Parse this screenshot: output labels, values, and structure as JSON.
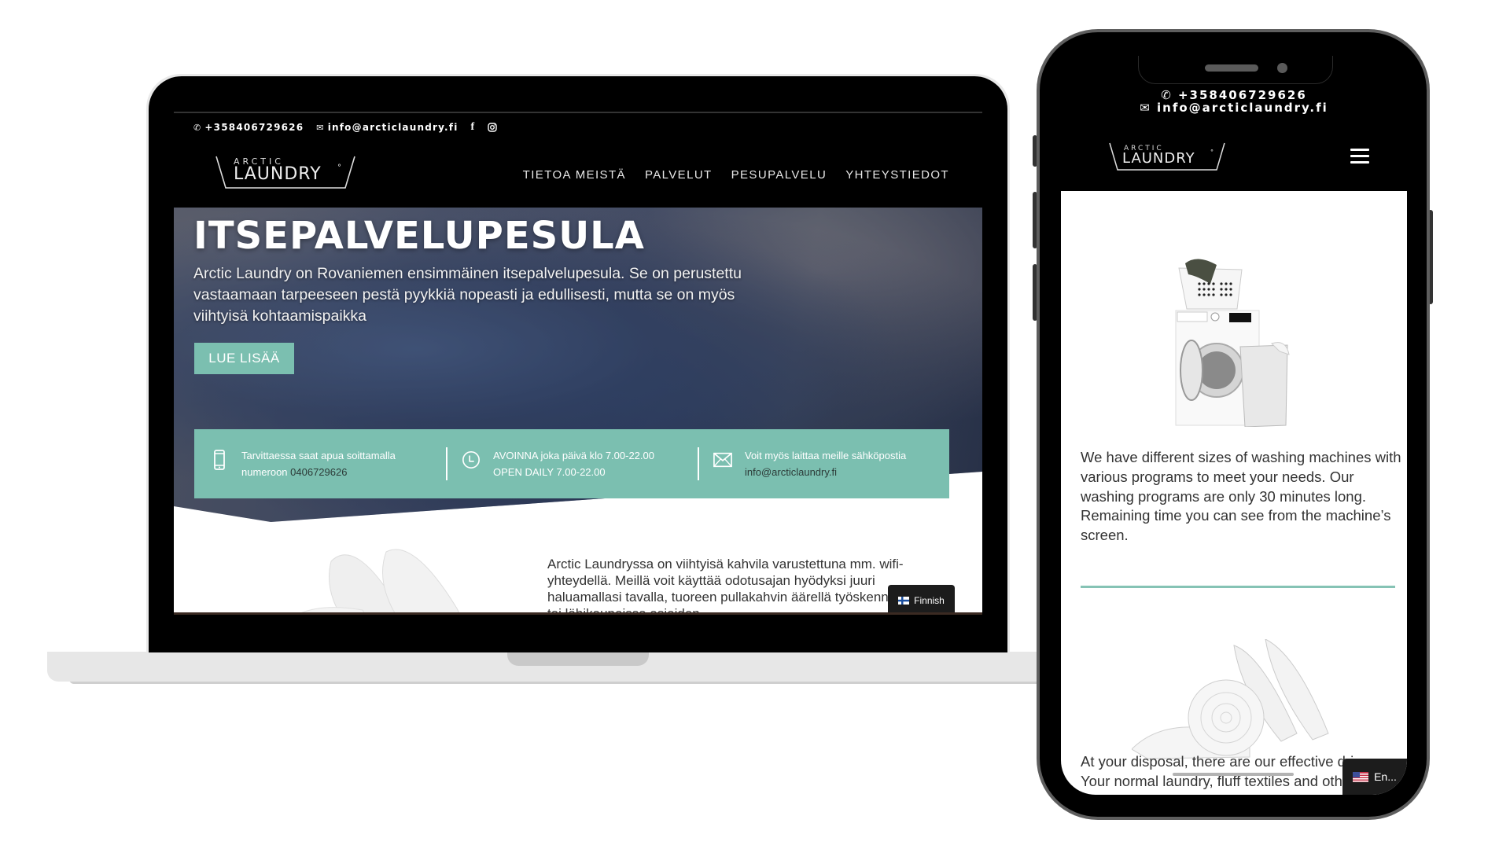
{
  "laptop": {
    "topbar": {
      "phone": "+358406729626",
      "email": "info@arcticlaundry.fi",
      "social": [
        "facebook",
        "instagram"
      ]
    },
    "logo": {
      "line1": "ARCTIC",
      "line2": "LAUNDRY",
      "mark": "°"
    },
    "nav": [
      {
        "label": "TIETOA MEISTÄ"
      },
      {
        "label": "PALVELUT"
      },
      {
        "label": "PESUPALVELU"
      },
      {
        "label": "YHTEYSTIEDOT"
      }
    ],
    "hero": {
      "title": "ITSEPALVELUPESULA",
      "text": "Arctic Laundry on Rovaniemen ensimmäinen itsepalvelupesula. Se on perustettu vastaamaan tarpeeseen pestä pyykkiä nopeasti ja edullisesti, mutta se on myös viihtyisä kohtaamispaikka",
      "button": "LUE LISÄÄ"
    },
    "info": [
      {
        "icon": "mobile-phone-icon",
        "line1": "Tarvittaessa saat apua soittamalla",
        "line2_prefix": "numeroon ",
        "line2_value": "0406729626"
      },
      {
        "icon": "clock-icon",
        "line1": "AVOINNA joka päivä klo 7.00-22.00",
        "line2_prefix": "OPEN DAILY 7.00-22.00",
        "line2_value": ""
      },
      {
        "icon": "envelope-icon",
        "line1": "Voit myös laittaa meille sähköpostia",
        "line2_prefix": "",
        "line2_value": "info@arcticlaundry.fi"
      }
    ],
    "lower_text": "Arctic Laundryssa on viihtyisä kahvila varustettuna mm. wifi-yhteydellä. Meillä voit käyttää odotusajan hyödyksi juuri haluamallasi tavalla, tuoreen pullakahvin äärellä työskennellen tai lähikaupoissa asioiden.",
    "language": {
      "flag": "finland-flag-icon",
      "label": "Finnish"
    }
  },
  "phone": {
    "contact": {
      "phone": "+358406729626",
      "email": "info@arcticlaundry.fi"
    },
    "logo": {
      "line1": "ARCTIC",
      "line2": "LAUNDRY",
      "mark": "°"
    },
    "text1": "We have different sizes of washing machines with various programs to meet your needs. Our washing programs are only 30 minutes long. Remaining time you can see from the machine’s screen.",
    "text2": "At your disposal, there are our effective driers. Your normal laundry, fluff textiles and other bigger items dry quickly.",
    "language": {
      "flag": "us-flag-icon",
      "label": "En..."
    }
  },
  "colors": {
    "accent": "#7bbfb0",
    "divider": "#86c3b5",
    "header_bg": "#000000",
    "text": "#333333"
  }
}
